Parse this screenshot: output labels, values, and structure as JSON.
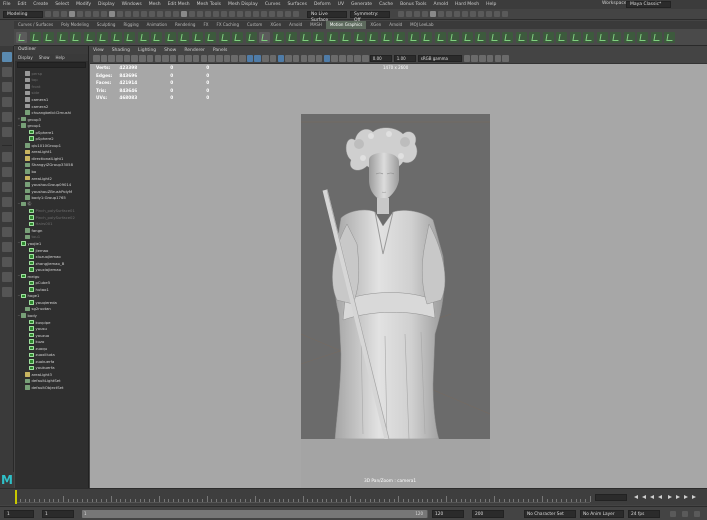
{
  "menubar": {
    "items": [
      "File",
      "Edit",
      "Create",
      "Select",
      "Modify",
      "Display",
      "Windows",
      "Mesh",
      "Edit Mesh",
      "Mesh Tools",
      "Mesh Display",
      "Curves",
      "Surfaces",
      "Deform",
      "UV",
      "Generate",
      "Cache",
      "Bonus Tools",
      "Arnold",
      "Hard Mesh",
      "Help"
    ],
    "workspace_label": "Workspace:",
    "workspace_value": "Maya Classic*"
  },
  "status_line": {
    "mode": "Modeling",
    "live_surface": "No Live Surface",
    "symmetry": "Symmetry: Off"
  },
  "shelf_tabs": {
    "items": [
      "Curves / Surfaces",
      "Poly Modeling",
      "Sculpting",
      "Rigging",
      "Animation",
      "Rendering",
      "FX",
      "FX Caching",
      "Custom",
      "XGen",
      "Arnold",
      "MASH",
      "Motion Graphics",
      "XGen",
      "Arnold",
      "MOJ LeeLab"
    ],
    "active_index": 12
  },
  "outliner": {
    "title": "Outliner",
    "menu": [
      "Display",
      "Show",
      "Help"
    ],
    "items": [
      {
        "label": "persp",
        "exp": "",
        "type": "cam",
        "indent": 1,
        "dim": true
      },
      {
        "label": "top",
        "exp": "",
        "type": "cam",
        "indent": 1,
        "dim": true
      },
      {
        "label": "front",
        "exp": "",
        "type": "cam",
        "indent": 1,
        "dim": true
      },
      {
        "label": "side",
        "exp": "",
        "type": "cam",
        "indent": 1,
        "dim": true
      },
      {
        "label": "camera1",
        "exp": "",
        "type": "cam",
        "indent": 1,
        "dim": false
      },
      {
        "label": "camera2",
        "exp": "",
        "type": "cam",
        "indent": 1,
        "dim": false
      },
      {
        "label": "chuangbeibl:l2mushi",
        "exp": "",
        "type": "grp",
        "indent": 1,
        "dim": false
      },
      {
        "label": "group3",
        "exp": "+",
        "type": "grp",
        "indent": 0,
        "dim": false
      },
      {
        "label": "group1",
        "exp": "−",
        "type": "grp",
        "indent": 0,
        "dim": false
      },
      {
        "label": "pSphere1",
        "exp": "",
        "type": "mesh",
        "indent": 2,
        "dim": false
      },
      {
        "label": "pSphere2",
        "exp": "",
        "type": "mesh",
        "indent": 2,
        "dim": false
      },
      {
        "label": "qiu1010Group1",
        "exp": "",
        "type": "grp",
        "indent": 1,
        "dim": false
      },
      {
        "label": "areaLight1",
        "exp": "",
        "type": "lit",
        "indent": 1,
        "dim": false
      },
      {
        "label": "directionalLight1",
        "exp": "",
        "type": "lit",
        "indent": 1,
        "dim": false
      },
      {
        "label": "ShangyiZGroup33058",
        "exp": "",
        "type": "grp",
        "indent": 1,
        "dim": false
      },
      {
        "label": "bo",
        "exp": "",
        "type": "grp",
        "indent": 1,
        "dim": false
      },
      {
        "label": "areaLight2",
        "exp": "",
        "type": "lit",
        "indent": 1,
        "dim": false
      },
      {
        "label": "youshouGroup09014",
        "exp": "",
        "type": "grp",
        "indent": 1,
        "dim": false
      },
      {
        "label": "youshouZBrushPolyM",
        "exp": "",
        "type": "grp",
        "indent": 1,
        "dim": false
      },
      {
        "label": "body1:Group1765",
        "exp": "",
        "type": "grp",
        "indent": 1,
        "dim": false
      },
      {
        "label": "Ⓖ",
        "exp": "−",
        "type": "grp",
        "indent": 0,
        "dim": false
      },
      {
        "label": "Pinch_polySurface01",
        "exp": "",
        "type": "mesh",
        "indent": 2,
        "dim": true
      },
      {
        "label": "Pinch_polySurface02",
        "exp": "",
        "type": "mesh",
        "indent": 2,
        "dim": true
      },
      {
        "label": "Hairs001",
        "exp": "",
        "type": "mesh",
        "indent": 2,
        "dim": true
      },
      {
        "label": "fangn",
        "exp": "",
        "type": "grp",
        "indent": 1,
        "dim": false
      },
      {
        "label": "tou1",
        "exp": "",
        "type": "grp",
        "indent": 1,
        "dim": true
      },
      {
        "label": "yaojie1",
        "exp": "−",
        "type": "mesh",
        "indent": 0,
        "dim": false
      },
      {
        "label": "jiemao",
        "exp": "",
        "type": "mesh",
        "indent": 2,
        "dim": false
      },
      {
        "label": "xiuzuojiemao",
        "exp": "",
        "type": "mesh",
        "indent": 2,
        "dim": false
      },
      {
        "label": "zhangjiemao_B",
        "exp": "",
        "type": "mesh",
        "indent": 2,
        "dim": false
      },
      {
        "label": "youxiajiemao",
        "exp": "",
        "type": "mesh",
        "indent": 2,
        "dim": false
      },
      {
        "label": "meigu",
        "exp": "−",
        "type": "mesh",
        "indent": 0,
        "dim": false
      },
      {
        "label": "pCube5",
        "exp": "",
        "type": "mesh",
        "indent": 2,
        "dim": false
      },
      {
        "label": "hutao1",
        "exp": "",
        "type": "mesh",
        "indent": 2,
        "dim": false
      },
      {
        "label": "hoge1",
        "exp": "−",
        "type": "mesh",
        "indent": 0,
        "dim": false
      },
      {
        "label": "youqiereda",
        "exp": "",
        "type": "mesh",
        "indent": 2,
        "dim": false
      },
      {
        "label": "sg2ruotan",
        "exp": "",
        "type": "grp",
        "indent": 1,
        "dim": false
      },
      {
        "label": "body",
        "exp": "−",
        "type": "grp",
        "indent": 0,
        "dim": false
      },
      {
        "label": "kuvpipe",
        "exp": "",
        "type": "mesh",
        "indent": 2,
        "dim": false
      },
      {
        "label": "yousu",
        "exp": "",
        "type": "mesh",
        "indent": 2,
        "dim": false
      },
      {
        "label": "youzuo",
        "exp": "",
        "type": "mesh",
        "indent": 2,
        "dim": false
      },
      {
        "label": "kuzo",
        "exp": "",
        "type": "mesh",
        "indent": 2,
        "dim": false
      },
      {
        "label": "zuoqu",
        "exp": "",
        "type": "mesh",
        "indent": 2,
        "dim": false
      },
      {
        "label": "zuoxilluda",
        "exp": "",
        "type": "mesh",
        "indent": 2,
        "dim": false
      },
      {
        "label": "zuokuerfa",
        "exp": "",
        "type": "mesh",
        "indent": 2,
        "dim": false
      },
      {
        "label": "youkuerfa",
        "exp": "",
        "type": "mesh",
        "indent": 2,
        "dim": false
      },
      {
        "label": "areaLight3",
        "exp": "",
        "type": "lit",
        "indent": 1,
        "dim": false
      },
      {
        "label": "defaultLightSet",
        "exp": "",
        "type": "grp",
        "indent": 1,
        "dim": false
      },
      {
        "label": "defaultObjectSet",
        "exp": "",
        "type": "grp",
        "indent": 1,
        "dim": false
      }
    ]
  },
  "viewport": {
    "menu": [
      "View",
      "Shading",
      "Lighting",
      "Show",
      "Renderer",
      "Panels"
    ],
    "field_a": "0.00",
    "field_b": "1.00",
    "colorspace": "sRGB gamma",
    "resolution": "1470 x 2600",
    "hud": [
      {
        "label": "Verts:",
        "v1": "423398",
        "v2": "0",
        "v3": "0"
      },
      {
        "label": "Edges:",
        "v1": "843696",
        "v2": "0",
        "v3": "0"
      },
      {
        "label": "Faces:",
        "v1": "421914",
        "v2": "0",
        "v3": "0"
      },
      {
        "label": "Tris:",
        "v1": "843646",
        "v2": "0",
        "v3": "0"
      },
      {
        "label": "UVs:",
        "v1": "468083",
        "v2": "0",
        "v3": "0"
      }
    ],
    "camera_label": "3D Pan/Zoom : camera1"
  },
  "timeline": {
    "current_frame": "1"
  },
  "range": {
    "start_outer": "1",
    "start_inner": "1",
    "slider_left": "1",
    "slider_right": "120",
    "end_inner": "120",
    "end_outer": "200",
    "character_set": "No Character Set",
    "anim_layer": "No Anim Layer",
    "fps": "24 fps"
  },
  "colors": {
    "accent_green": "#7fcf7f",
    "viewport_bg": "#a7a7a7",
    "playhead": "#c8c800",
    "maya_logo": "#2fc0c8"
  }
}
